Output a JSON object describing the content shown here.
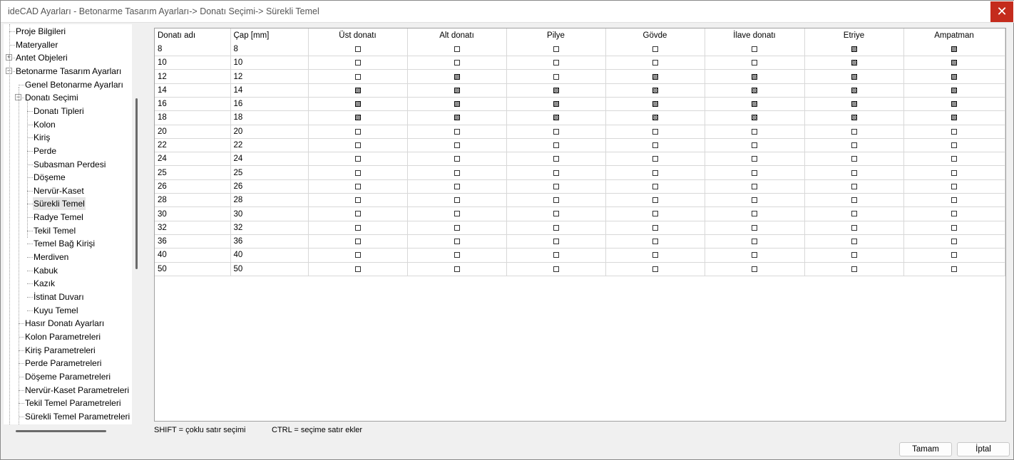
{
  "window": {
    "title": "ideCAD Ayarları - Betonarme Tasarım Ayarları-> Donatı Seçimi-> Sürekli Temel",
    "close_icon": "close-icon"
  },
  "tree": [
    {
      "label": "Proje Bilgileri",
      "level": 0
    },
    {
      "label": "Materyaller",
      "level": 0
    },
    {
      "label": "Antet Objeleri",
      "level": 0,
      "expander": "+"
    },
    {
      "label": "Betonarme Tasarım Ayarları",
      "level": 0,
      "expander": "-"
    },
    {
      "label": "Genel Betonarme Ayarları",
      "level": 1
    },
    {
      "label": "Donatı Seçimi",
      "level": 1,
      "expander": "-"
    },
    {
      "label": "Donatı Tipleri",
      "level": 2
    },
    {
      "label": "Kolon",
      "level": 2
    },
    {
      "label": "Kiriş",
      "level": 2
    },
    {
      "label": "Perde",
      "level": 2
    },
    {
      "label": "Subasman Perdesi",
      "level": 2
    },
    {
      "label": "Döşeme",
      "level": 2
    },
    {
      "label": "Nervür-Kaset",
      "level": 2
    },
    {
      "label": "Sürekli Temel",
      "level": 2,
      "selected": true
    },
    {
      "label": "Radye Temel",
      "level": 2
    },
    {
      "label": "Tekil Temel",
      "level": 2
    },
    {
      "label": "Temel Bağ Kirişi",
      "level": 2
    },
    {
      "label": "Merdiven",
      "level": 2
    },
    {
      "label": "Kabuk",
      "level": 2
    },
    {
      "label": "Kazık",
      "level": 2
    },
    {
      "label": "İstinat Duvarı",
      "level": 2
    },
    {
      "label": "Kuyu Temel",
      "level": 2
    },
    {
      "label": "Hasır Donatı Ayarları",
      "level": 1
    },
    {
      "label": "Kolon Parametreleri",
      "level": 1
    },
    {
      "label": "Kiriş Parametreleri",
      "level": 1
    },
    {
      "label": "Perde Parametreleri",
      "level": 1
    },
    {
      "label": "Döşeme Parametreleri",
      "level": 1
    },
    {
      "label": "Nervür-Kaset Parametreleri",
      "level": 1
    },
    {
      "label": "Tekil Temel Parametreleri",
      "level": 1
    },
    {
      "label": "Sürekli Temel Parametreleri",
      "level": 1
    }
  ],
  "table": {
    "columns": [
      "Donatı adı",
      "Çap [mm]",
      "Üst donatı",
      "Alt  donatı",
      "Pilye",
      "Gövde",
      "İlave donatı",
      "Etriye",
      "Ampatman"
    ],
    "rows": [
      {
        "name": "8",
        "dia": "8",
        "checks": [
          false,
          false,
          false,
          false,
          false,
          true,
          true
        ]
      },
      {
        "name": "10",
        "dia": "10",
        "checks": [
          false,
          false,
          false,
          false,
          false,
          true,
          true
        ]
      },
      {
        "name": "12",
        "dia": "12",
        "checks": [
          false,
          true,
          false,
          true,
          true,
          true,
          true
        ]
      },
      {
        "name": "14",
        "dia": "14",
        "checks": [
          true,
          true,
          true,
          true,
          true,
          true,
          true
        ]
      },
      {
        "name": "16",
        "dia": "16",
        "checks": [
          true,
          true,
          true,
          true,
          true,
          true,
          true
        ]
      },
      {
        "name": "18",
        "dia": "18",
        "checks": [
          true,
          true,
          true,
          true,
          true,
          true,
          true
        ]
      },
      {
        "name": "20",
        "dia": "20",
        "checks": [
          false,
          false,
          false,
          false,
          false,
          false,
          false
        ]
      },
      {
        "name": "22",
        "dia": "22",
        "checks": [
          false,
          false,
          false,
          false,
          false,
          false,
          false
        ]
      },
      {
        "name": "24",
        "dia": "24",
        "checks": [
          false,
          false,
          false,
          false,
          false,
          false,
          false
        ]
      },
      {
        "name": "25",
        "dia": "25",
        "checks": [
          false,
          false,
          false,
          false,
          false,
          false,
          false
        ]
      },
      {
        "name": "26",
        "dia": "26",
        "checks": [
          false,
          false,
          false,
          false,
          false,
          false,
          false
        ]
      },
      {
        "name": "28",
        "dia": "28",
        "checks": [
          false,
          false,
          false,
          false,
          false,
          false,
          false
        ]
      },
      {
        "name": "30",
        "dia": "30",
        "checks": [
          false,
          false,
          false,
          false,
          false,
          false,
          false
        ]
      },
      {
        "name": "32",
        "dia": "32",
        "checks": [
          false,
          false,
          false,
          false,
          false,
          false,
          false
        ]
      },
      {
        "name": "36",
        "dia": "36",
        "checks": [
          false,
          false,
          false,
          false,
          false,
          false,
          false
        ]
      },
      {
        "name": "40",
        "dia": "40",
        "checks": [
          false,
          false,
          false,
          false,
          false,
          false,
          false
        ]
      },
      {
        "name": "50",
        "dia": "50",
        "checks": [
          false,
          false,
          false,
          false,
          false,
          false,
          false
        ]
      }
    ]
  },
  "hints": {
    "shift": "SHIFT = çoklu satır seçimi",
    "ctrl": "CTRL = seçime satır ekler"
  },
  "buttons": {
    "ok": "Tamam",
    "cancel": "İptal"
  }
}
